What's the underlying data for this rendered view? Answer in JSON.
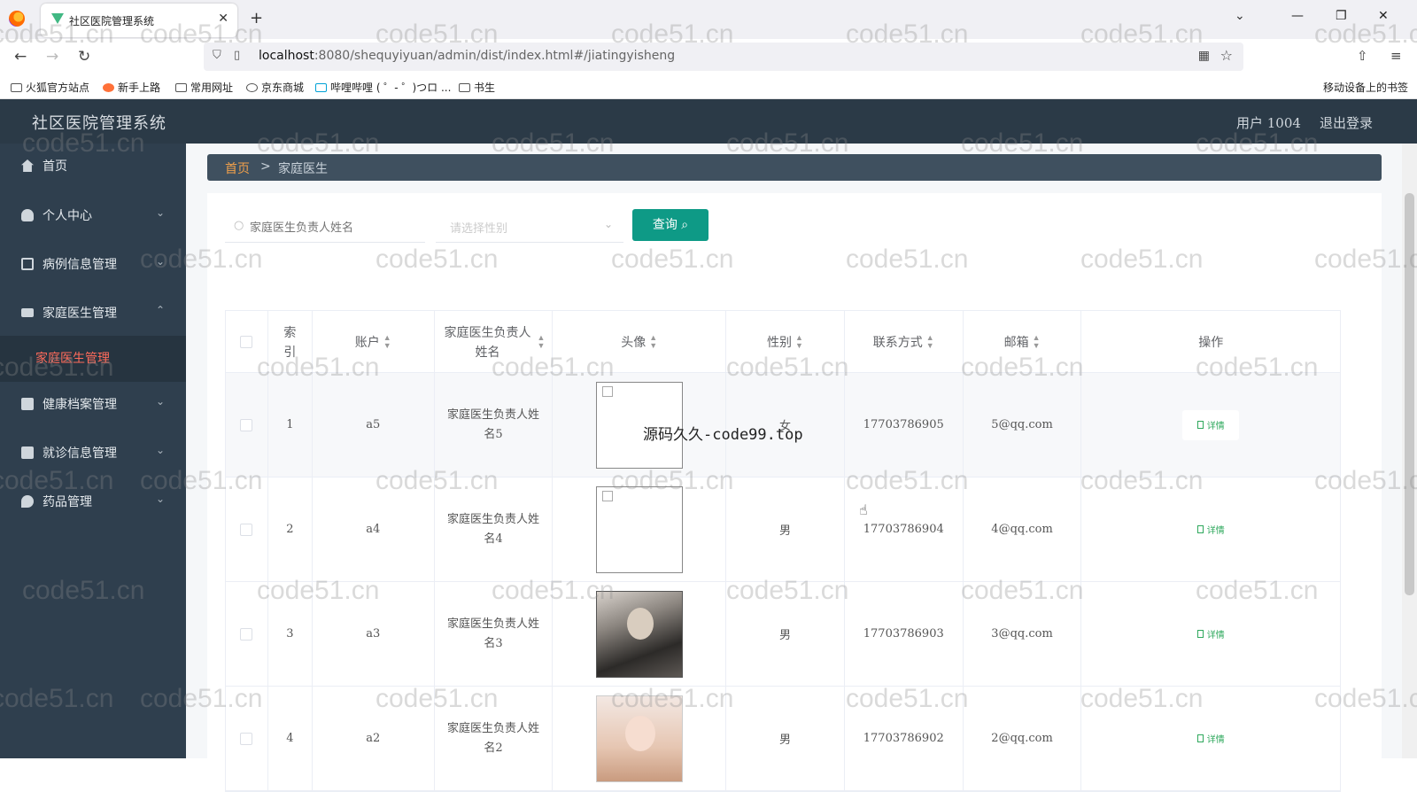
{
  "browser": {
    "tab_title": "社区医院管理系统",
    "url_host": "localhost",
    "url_rest": ":8080/shequyiyuan/admin/dist/index.html#/jiatingyisheng",
    "bookmarks": [
      "火狐官方站点",
      "新手上路",
      "常用网址",
      "京东商城",
      "哔哩哔哩 ( ゜- ゜)つロ ...",
      "书生"
    ],
    "mobile_bookmarks": "移动设备上的书签"
  },
  "header": {
    "title": "社区医院管理系统",
    "user": "用户 1004",
    "logout": "退出登录"
  },
  "sidebar": {
    "items": [
      {
        "label": "首页"
      },
      {
        "label": "个人中心"
      },
      {
        "label": "病例信息管理"
      },
      {
        "label": "家庭医生管理"
      },
      {
        "label": "健康档案管理"
      },
      {
        "label": "就诊信息管理"
      },
      {
        "label": "药品管理"
      }
    ],
    "submenu_active": "家庭医生管理"
  },
  "breadcrumb": {
    "home": "首页",
    "sep": ">",
    "current": "家庭医生"
  },
  "search": {
    "name_placeholder": "家庭医生负责人姓名",
    "gender_placeholder": "请选择性别",
    "query_label": "查询"
  },
  "table": {
    "headers": [
      "索引",
      "账户",
      "家庭医生负责人姓名",
      "头像",
      "性别",
      "联系方式",
      "邮箱",
      "操作"
    ],
    "rows": [
      {
        "index": "1",
        "account": "a5",
        "name": "家庭医生负责人姓名5",
        "gender": "女",
        "phone": "17703786905",
        "email": "5@qq.com",
        "action": "详情"
      },
      {
        "index": "2",
        "account": "a4",
        "name": "家庭医生负责人姓名4",
        "gender": "男",
        "phone": "17703786904",
        "email": "4@qq.com",
        "action": "详情"
      },
      {
        "index": "3",
        "account": "a3",
        "name": "家庭医生负责人姓名3",
        "gender": "男",
        "phone": "17703786903",
        "email": "3@qq.com",
        "action": "详情"
      },
      {
        "index": "4",
        "account": "a2",
        "name": "家庭医生负责人姓名2",
        "gender": "男",
        "phone": "17703786902",
        "email": "2@qq.com",
        "action": "详情"
      }
    ]
  },
  "overlay_text": "源码久久-code99.top",
  "watermark": "code51.cn",
  "colors": {
    "accent": "#0e9a86",
    "header_bg": "#2b3a47",
    "sidebar_bg": "#2f3f4e",
    "active_sub": "#ff6b5b",
    "breadcrumb_home": "#f0a04b"
  }
}
